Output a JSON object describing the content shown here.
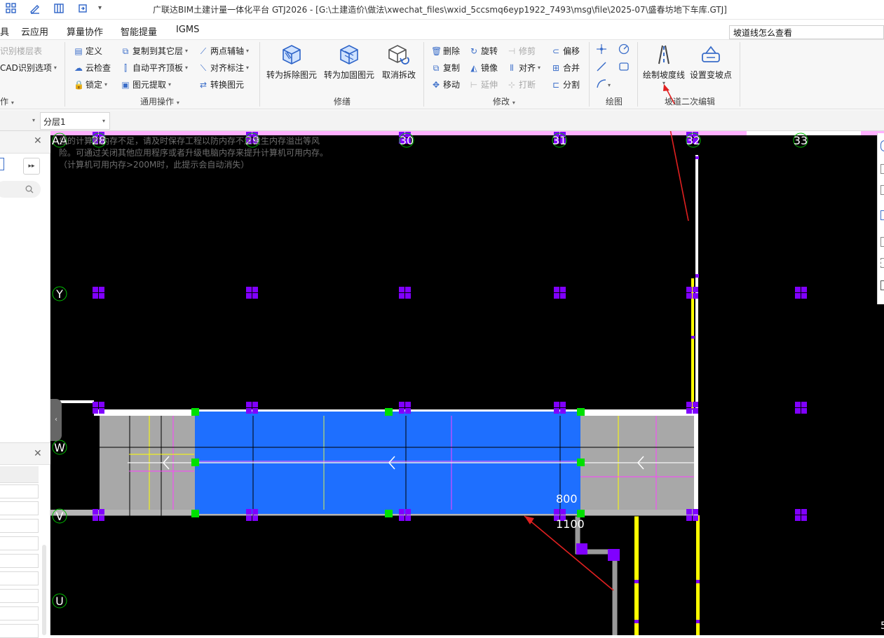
{
  "window": {
    "title": "广联达BIM土建计量一体化平台 GTJ2026 - [G:\\土建造价\\做法\\xwechat_files\\wxid_5ccsmq6eyp1922_7493\\msg\\file\\2025-07\\盛春坊地下车库.GTJ]",
    "quick_access_icons": [
      "grid-icon",
      "pen-icon",
      "columns-icon",
      "sync-icon"
    ],
    "dropdown_glyph": "▾"
  },
  "menu": {
    "tabs": [
      "具",
      "云应用",
      "算量协作",
      "智能提量",
      "IGMS"
    ]
  },
  "search": {
    "value": "坡道线怎么查看"
  },
  "ribbon": {
    "cad": {
      "items": [
        "识别楼层表",
        "CAD识别选项"
      ],
      "label": "作"
    },
    "general": {
      "label": "通用操作",
      "items": [
        "定义",
        "复制到其它层",
        "两点辅轴",
        "云检查",
        "自动平齐顶板",
        "对齐标注",
        "锁定",
        "图元提取",
        "转换图元"
      ]
    },
    "repair": {
      "label": "修缮",
      "items": [
        "转为拆除图元",
        "转为加固图元",
        "取消拆改"
      ]
    },
    "modify": {
      "label": "修改",
      "items": [
        "删除",
        "旋转",
        "修剪",
        "偏移",
        "复制",
        "镜像",
        "对齐",
        "合并",
        "移动",
        "延伸",
        "打断",
        "分割"
      ]
    },
    "draw": {
      "label": "绘图"
    },
    "ramp": {
      "label": "坡道二次编辑",
      "items": [
        "绘制坡度线",
        "设置变坡点"
      ]
    }
  },
  "layer": {
    "floor_value": "",
    "layer_value": "分层1"
  },
  "canvas": {
    "memory_warning": "您的计算机内存不足，请及时保存工程以防内存不足发生内存溢出等风险。可通过关闭其他应用程序或者升级电脑内存来提升计算机可用内存。（计算机可用内存>200M时，此提示会自动消失）",
    "axis_top": [
      "28",
      "29",
      "30",
      "31",
      "32",
      "33"
    ],
    "axis_left": [
      "AA",
      "Y",
      "W",
      "V",
      "U"
    ],
    "dimensions": [
      "800",
      "1100"
    ],
    "colors": {
      "ramp_blue": "#1e6fff",
      "grip_green": "#00e000",
      "column_purple": "#8000ff",
      "yellow_wall": "#ffff00",
      "arrow_red": "#e02020"
    }
  },
  "footer_glyph": "5"
}
